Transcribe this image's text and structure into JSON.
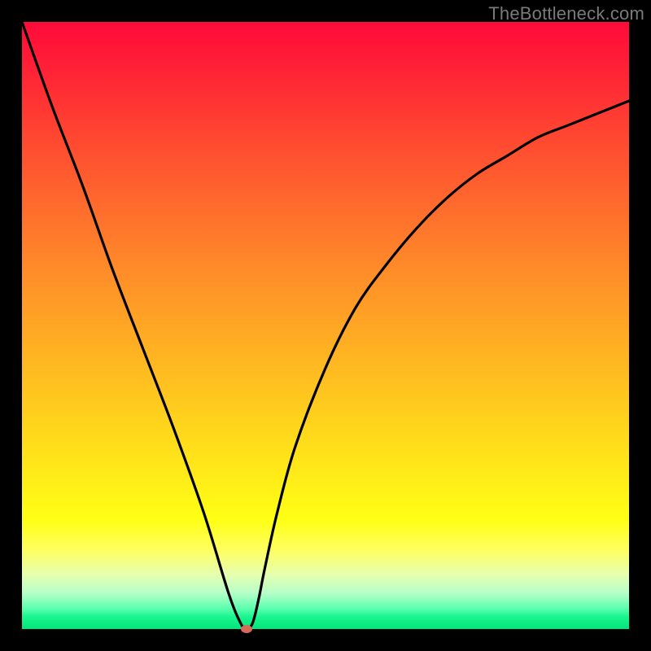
{
  "watermark": "TheBottleneck.com",
  "chart_data": {
    "type": "line",
    "title": "",
    "xlabel": "",
    "ylabel": "",
    "xlim": [
      0,
      100
    ],
    "ylim": [
      0,
      100
    ],
    "grid": false,
    "legend": false,
    "series": [
      {
        "name": "curve",
        "x": [
          0,
          5,
          10,
          15,
          20,
          25,
          30,
          34,
          36,
          37,
          38,
          39,
          40,
          42,
          45,
          50,
          55,
          60,
          65,
          70,
          75,
          80,
          85,
          90,
          95,
          100
        ],
        "values": [
          100,
          86,
          73,
          59,
          46,
          33,
          19,
          6,
          1,
          0,
          1,
          5,
          10,
          19,
          30,
          43,
          53,
          60,
          66,
          71,
          75,
          78,
          81,
          83,
          85,
          87
        ]
      }
    ],
    "marker": {
      "x": 37,
      "y": 0,
      "color": "#d66a5a"
    },
    "background_gradient": {
      "direction": "vertical",
      "stops": [
        {
          "pos": 0.0,
          "color": "#ff0a3a"
        },
        {
          "pos": 0.3,
          "color": "#ff6a2d"
        },
        {
          "pos": 0.55,
          "color": "#ffb422"
        },
        {
          "pos": 0.82,
          "color": "#ffff15"
        },
        {
          "pos": 0.94,
          "color": "#b8ffc8"
        },
        {
          "pos": 1.0,
          "color": "#00e67a"
        }
      ]
    }
  }
}
